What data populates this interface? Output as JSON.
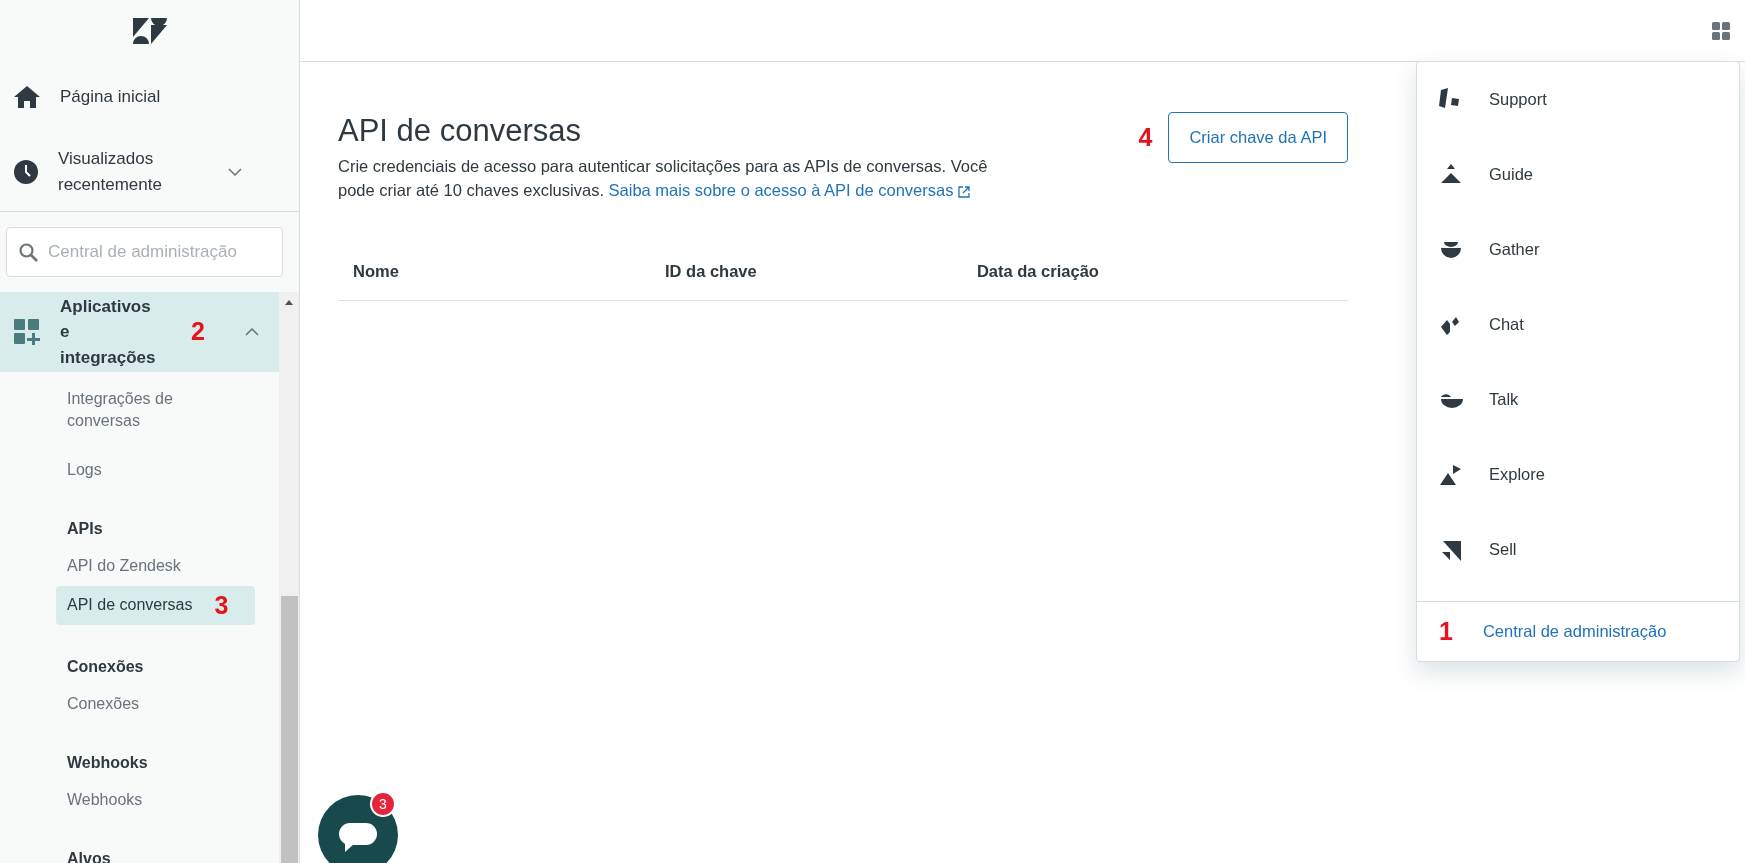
{
  "sidebar": {
    "nav": [
      {
        "label": "Página inicial",
        "kind": "home"
      },
      {
        "label": "Visualizados recentemente",
        "kind": "recent",
        "expanded": false
      }
    ],
    "search": {
      "placeholder": "Central de administração"
    },
    "section": {
      "label": "Aplicativos e integrações",
      "expanded": true,
      "selected": true,
      "annotation": "2"
    },
    "groups": [
      {
        "items": [
          {
            "label": "Integrações de conversas",
            "selected": false
          }
        ]
      },
      {
        "items": [
          {
            "label": "Logs",
            "selected": false
          }
        ]
      },
      {
        "heading": "APIs",
        "items": [
          {
            "label": "API do Zendesk",
            "selected": false
          },
          {
            "label": "API de conversas",
            "selected": true,
            "annotation": "3"
          }
        ]
      },
      {
        "heading": "Conexões",
        "items": [
          {
            "label": "Conexões",
            "selected": false
          }
        ]
      },
      {
        "heading": "Webhooks",
        "items": [
          {
            "label": "Webhooks",
            "selected": false
          }
        ]
      },
      {
        "heading": "Alvos"
      }
    ]
  },
  "main": {
    "title": "API de conversas",
    "description": "Crie credenciais de acesso para autenticar solicitações para as APIs de conversas. Você pode criar até 10 chaves exclusivas.",
    "link": "Saiba mais sobre o acesso à API de conversas",
    "button": {
      "label": "Criar chave da API",
      "annotation": "4"
    },
    "table": {
      "columns": [
        "Nome",
        "ID da chave",
        "Data da criação"
      ]
    }
  },
  "product_menu": {
    "items": [
      {
        "label": "Support"
      },
      {
        "label": "Guide"
      },
      {
        "label": "Gather"
      },
      {
        "label": "Chat"
      },
      {
        "label": "Talk"
      },
      {
        "label": "Explore"
      },
      {
        "label": "Sell"
      }
    ],
    "admin_link": {
      "label": "Central de administração",
      "annotation": "1"
    }
  },
  "chat_widget": {
    "badge": "3"
  }
}
